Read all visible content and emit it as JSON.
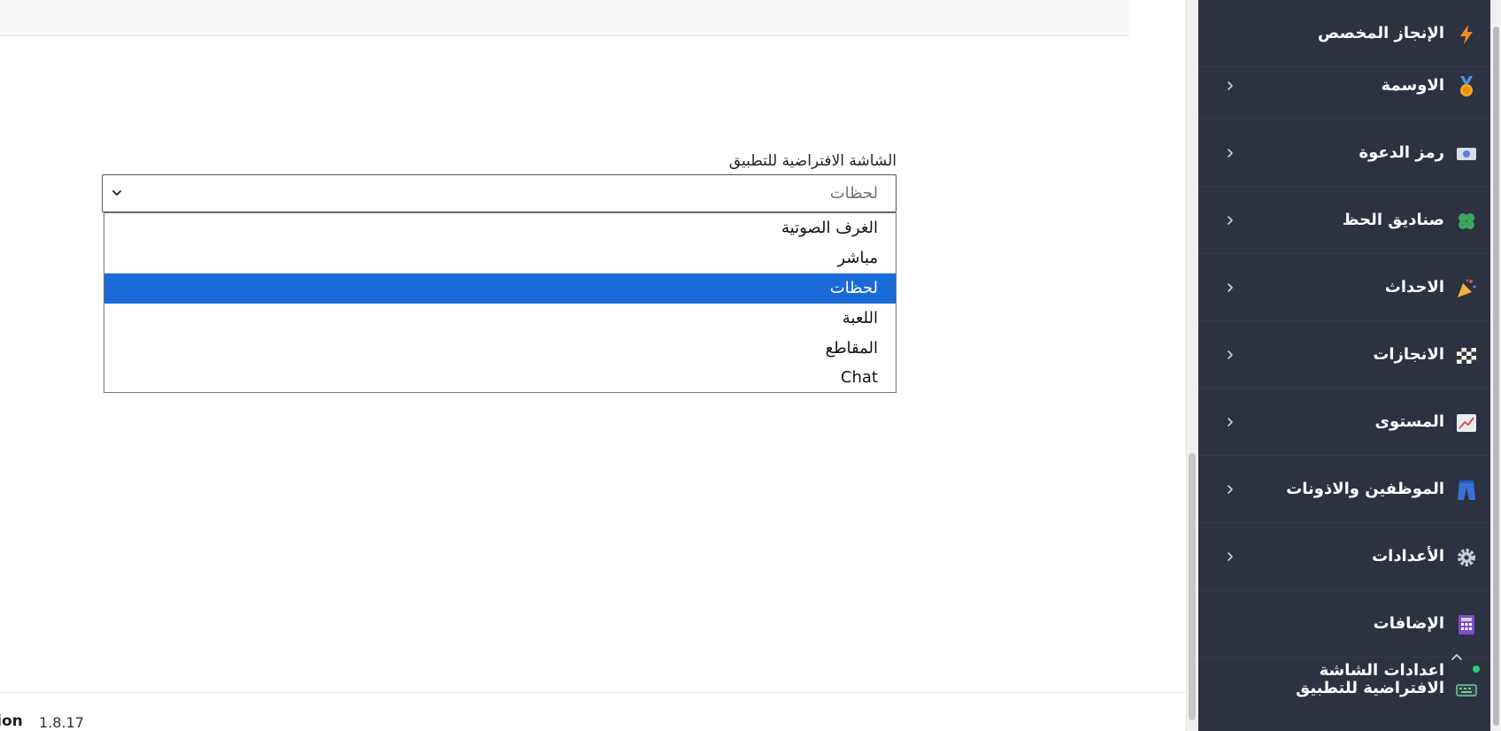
{
  "form": {
    "label": "الشاشة الافتراضية للتطبيق",
    "selected_value": "لحظات",
    "options": [
      "الغرف الصوتية",
      "مباشر",
      "لحظات",
      "اللعبة",
      "المقاطع",
      "Chat"
    ],
    "selected_index": 2
  },
  "footer": {
    "version_label": "sion",
    "version": "1.8.17"
  },
  "sidebar": {
    "items": [
      {
        "label": "الإنجاز المخصص",
        "icon": "lightning-icon"
      },
      {
        "label": "الاوسمة",
        "icon": "medal-icon"
      },
      {
        "label": "رمز الدعوة",
        "icon": "invite-ticket-icon"
      },
      {
        "label": "صناديق الحظ",
        "icon": "clover-icon"
      },
      {
        "label": "الاحداث",
        "icon": "party-popper-icon"
      },
      {
        "label": "الانجازات",
        "icon": "checkered-flag-icon"
      },
      {
        "label": "المستوى",
        "icon": "chart-up-icon"
      },
      {
        "label": "الموظفين والاذونات",
        "icon": "jeans-icon"
      },
      {
        "label": "الأعدادات",
        "icon": "gear-icon"
      },
      {
        "label": "الإضافات",
        "icon": "abacus-icon"
      },
      {
        "label": "اعدادات الشاشة الافتراضية للتطبيق",
        "icon": "keyboard-icon"
      }
    ]
  },
  "colors": {
    "sidebar_bg": "#2c3240",
    "selected_option": "#1a6ad8",
    "status_dot": "#2ecc71"
  }
}
